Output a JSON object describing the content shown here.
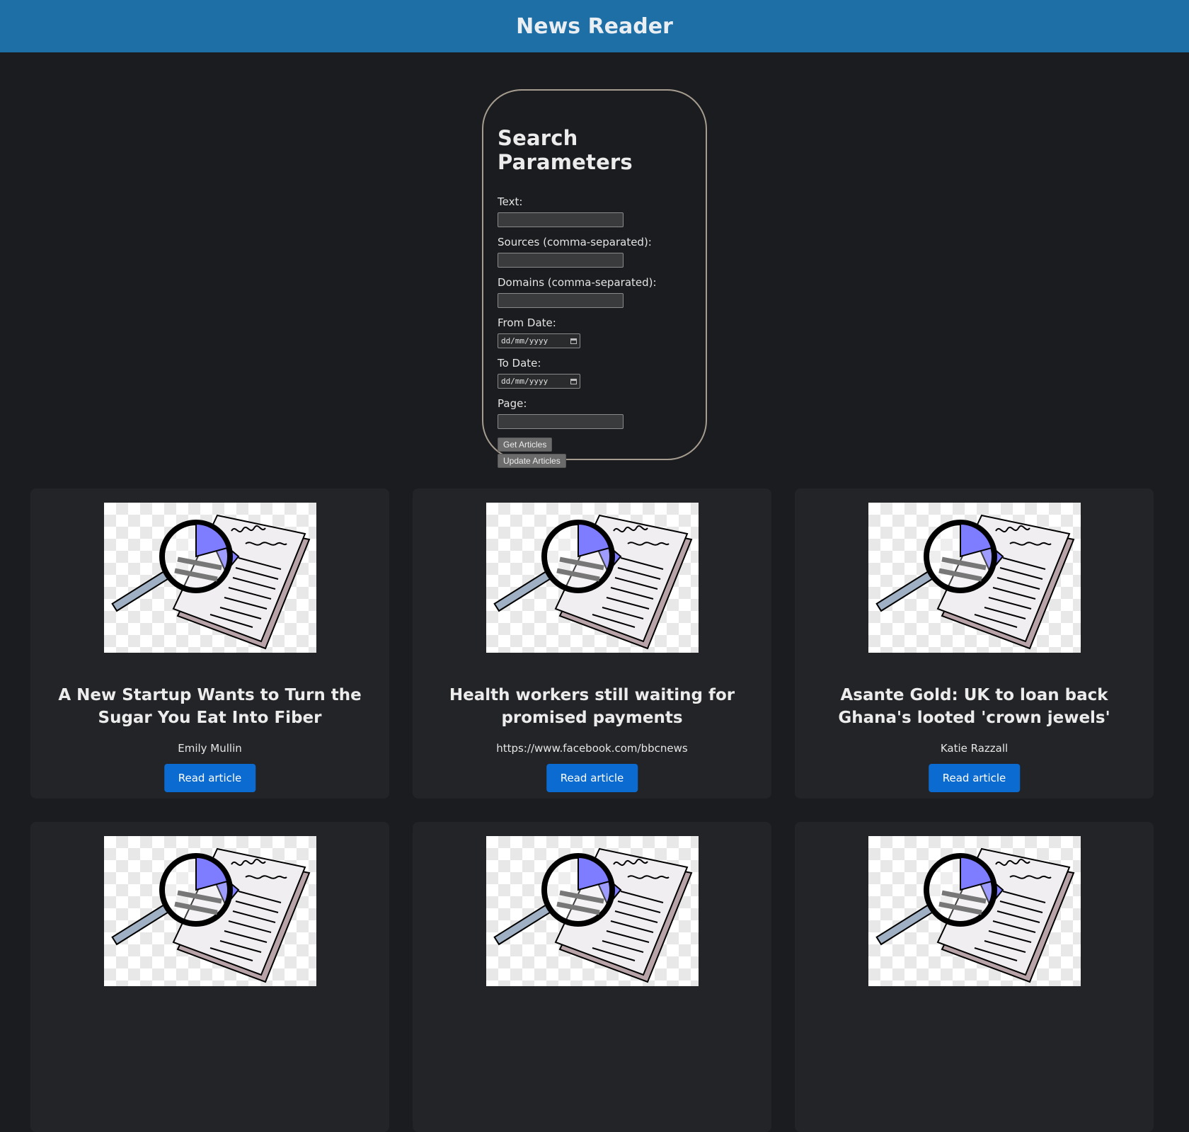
{
  "app": {
    "title": "News Reader"
  },
  "search": {
    "heading": "Search Parameters",
    "fields": {
      "text_label": "Text:",
      "text_value": "",
      "sources_label": "Sources (comma-separated):",
      "sources_value": "",
      "domains_label": "Domains (comma-separated):",
      "domains_value": "",
      "from_label": "From Date:",
      "from_placeholder": "dd/mm/yyyy",
      "to_label": "To Date:",
      "to_placeholder": "dd/mm/yyyy",
      "page_label": "Page:",
      "page_value": ""
    },
    "get_button": "Get Articles",
    "update_button": "Update Articles"
  },
  "articles": [
    {
      "title": "A New Startup Wants to Turn the Sugar You Eat Into Fiber",
      "author": "Emily Mullin",
      "button": "Read article",
      "image_icon": "document-magnifier-icon"
    },
    {
      "title": "Health workers still waiting for promised payments",
      "author": "https://www.facebook.com/bbcnews",
      "button": "Read article",
      "image_icon": "document-magnifier-icon"
    },
    {
      "title": "Asante Gold: UK to loan back Ghana's looted 'crown jewels'",
      "author": "Katie Razzall",
      "button": "Read article",
      "image_icon": "document-magnifier-icon"
    },
    {
      "title": "",
      "author": "",
      "button": "",
      "image_icon": "document-magnifier-icon"
    },
    {
      "title": "",
      "author": "",
      "button": "",
      "image_icon": "document-magnifier-icon"
    },
    {
      "title": "",
      "author": "",
      "button": "",
      "image_icon": "document-magnifier-icon"
    }
  ],
  "colors": {
    "header": "#1f6fa7",
    "background": "#1b1c1f",
    "card": "#232427",
    "primary_button": "#0b6bd0",
    "panel_border": "#a59c8f"
  }
}
